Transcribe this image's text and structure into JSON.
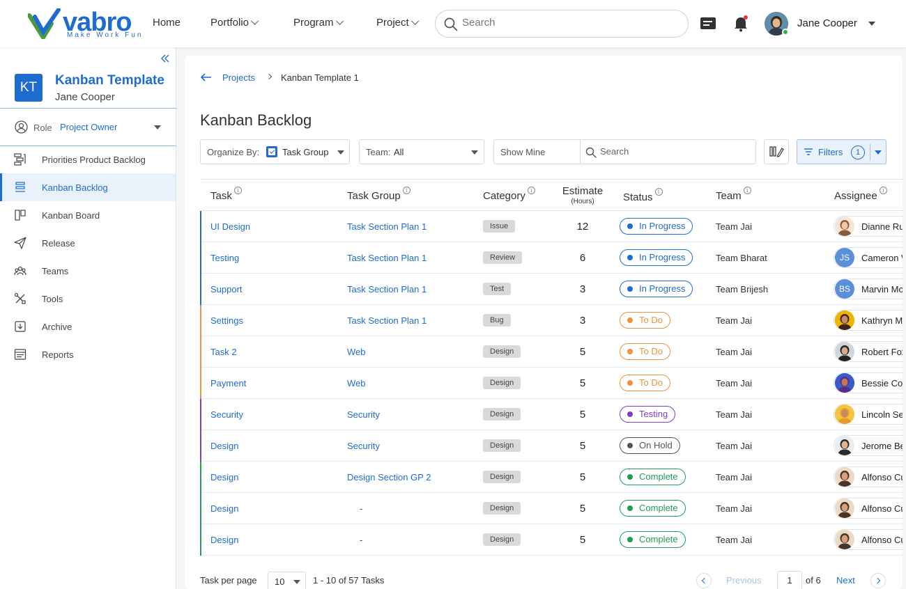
{
  "brand": {
    "name": "vabro",
    "tagline": "Make Work Fun"
  },
  "nav": {
    "home": "Home",
    "portfolio": "Portfolio",
    "program": "Program",
    "project": "Project",
    "search_placeholder": "Search"
  },
  "user": {
    "name": "Jane Cooper"
  },
  "sidebar": {
    "badge": "KT",
    "project_name": "Kanban Template",
    "owner": "Jane Cooper",
    "role_label": "Role",
    "role_value": "Project Owner",
    "items": [
      {
        "label": "Priorities Product Backlog",
        "icon": "backlog-icon"
      },
      {
        "label": "Kanban Backlog",
        "icon": "kanban-backlog-icon",
        "active": true
      },
      {
        "label": "Kanban Board",
        "icon": "board-icon"
      },
      {
        "label": "Release",
        "icon": "send-icon"
      },
      {
        "label": "Teams",
        "icon": "teams-icon"
      },
      {
        "label": "Tools",
        "icon": "tools-icon"
      },
      {
        "label": "Archive",
        "icon": "archive-icon"
      },
      {
        "label": "Reports",
        "icon": "reports-icon"
      }
    ]
  },
  "breadcrumb": {
    "parent": "Projects",
    "current": "Kanban Template 1"
  },
  "page_title": "Kanban Backlog",
  "toolbar": {
    "organize_label": "Organize By:",
    "organize_value": "Task Group",
    "team_label": "Team:",
    "team_value": "All",
    "show_mine": "Show Mine",
    "search_placeholder": "Search",
    "filters_label": "Filters",
    "filters_count": "1"
  },
  "table": {
    "headers": {
      "task": "Task",
      "task_group": "Task Group",
      "category": "Category",
      "estimate": "Estimate",
      "estimate_unit": "(Hours)",
      "status": "Status",
      "team": "Team",
      "assignee": "Assignee"
    },
    "rows": [
      {
        "task": "UI Design",
        "group": "Task Section Plan 1",
        "category": "Issue",
        "estimate": "12",
        "status": "In Progress",
        "team": "Team Jai",
        "assignee": "Dianne Russell",
        "initials": "",
        "accent": "#1e6ccf"
      },
      {
        "task": "Testing",
        "group": "Task Section Plan 1",
        "category": "Review",
        "estimate": "6",
        "status": "In Progress",
        "team": "Team Bharat",
        "assignee": "Cameron Williamson",
        "initials": "JS",
        "accent": "#1e6ccf"
      },
      {
        "task": "Support",
        "group": "Task Section Plan 1",
        "category": "Test",
        "estimate": "3",
        "status": "In Progress",
        "team": "Team Brijesh",
        "assignee": "Marvin McKinney",
        "initials": "BS",
        "accent": "#1e6ccf"
      },
      {
        "task": "Settings",
        "group": "Task Section Plan 1",
        "category": "Bug",
        "estimate": "3",
        "status": "To Do",
        "team": "Team Jai",
        "assignee": "Kathryn Murphy",
        "initials": "",
        "accent": "#f0923a"
      },
      {
        "task": "Task 2",
        "group": "Web",
        "category": "Design",
        "estimate": "5",
        "status": "To Do",
        "team": "Team Jai",
        "assignee": "Robert Fox",
        "initials": "",
        "accent": "#f0923a"
      },
      {
        "task": "Payment",
        "group": "Web",
        "category": "Design",
        "estimate": "5",
        "status": "To Do",
        "team": "Team Jai",
        "assignee": "Bessie Cooper",
        "initials": "",
        "accent": "#f0923a"
      },
      {
        "task": "Security",
        "group": "Security",
        "category": "Design",
        "estimate": "5",
        "status": "Testing",
        "team": "Team Jai",
        "assignee": "Lincoln Septimus",
        "initials": "",
        "accent": "#7b3fc4"
      },
      {
        "task": "Design",
        "group": "Security",
        "category": "Design",
        "estimate": "5",
        "status": "On Hold",
        "team": "Team Jai",
        "assignee": "Jerome Bell",
        "initials": "",
        "accent": "#7b3fc4"
      },
      {
        "task": "Design",
        "group": "Design Section GP 2",
        "category": "Design",
        "estimate": "5",
        "status": "Complete",
        "team": "Team Jai",
        "assignee": "Alfonso Culhane",
        "initials": "",
        "accent": "#1f9d55"
      },
      {
        "task": "Design",
        "group": "-",
        "category": "Design",
        "estimate": "5",
        "status": "Complete",
        "team": "Team Jai",
        "assignee": "Alfonso Culhane",
        "initials": "",
        "accent": "#1f9d55"
      },
      {
        "task": "Design",
        "group": "-",
        "category": "Design",
        "estimate": "5",
        "status": "Complete",
        "team": "Team Jai",
        "assignee": "Alfonso Culhane",
        "initials": "",
        "accent": "#1f9d55"
      }
    ]
  },
  "status_colors": {
    "In Progress": "#1e6ccf",
    "To Do": "#f0923a",
    "Testing": "#7b3fc4",
    "On Hold": "#555555",
    "Complete": "#1f9d55"
  },
  "pagination": {
    "per_page_label": "Task per page",
    "per_page": "10",
    "range": "1 - 10 of 57 Tasks",
    "previous": "Previous",
    "page": "1",
    "of": "of 6",
    "next": "Next"
  }
}
